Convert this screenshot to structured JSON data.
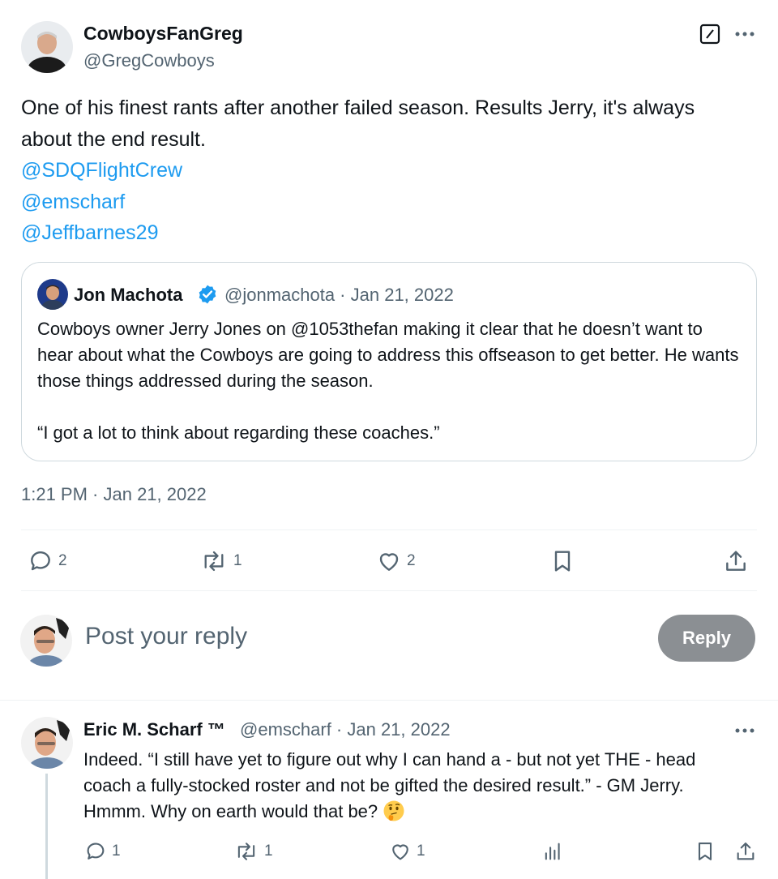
{
  "tweet": {
    "author_name": "CowboysFanGreg",
    "author_handle": "@GregCowboys",
    "text_line1": "One of his finest rants after another failed season. Results Jerry, it's always about the end result.",
    "mentions": [
      "@SDQFlightCrew",
      "@emscharf",
      "@Jeffbarnes29"
    ],
    "timestamp": "1:21 PM · Jan 21, 2022",
    "actions": {
      "replies": "2",
      "reposts": "1",
      "likes": "2"
    }
  },
  "quote": {
    "name": "Jon Machota",
    "handle_date": "@jonmachota · Jan 21, 2022",
    "text": "Cowboys owner Jerry Jones on @1053thefan making it clear that he doesn’t want to hear about what the Cowboys are going to address this offseason to get better. He wants those things addressed during the season.\n\n“I got a lot to think about regarding these coaches.”"
  },
  "composer": {
    "placeholder": "Post your reply",
    "button_label": "Reply"
  },
  "reply": {
    "name": "Eric M. Scharf ™",
    "handle_date": "@emscharf · Jan 21, 2022",
    "text": "Indeed. “I still have yet to figure out why I can hand a - but not yet THE - head coach a fully-stocked roster and not be gifted the desired result.” - GM Jerry. Hmmm. Why on earth would that be?",
    "actions": {
      "replies": "1",
      "reposts": "1",
      "likes": "1"
    }
  },
  "colors": {
    "link": "#1d9bf0",
    "secondary_text": "#536471",
    "verified": "#1d9bf0",
    "reply_button_disabled": "#8b8f93"
  },
  "icons": [
    "grok-icon",
    "more-icon",
    "verified-icon",
    "reply-icon",
    "repost-icon",
    "like-icon",
    "bookmark-icon",
    "share-icon",
    "views-icon",
    "thinking-face-emoji"
  ]
}
